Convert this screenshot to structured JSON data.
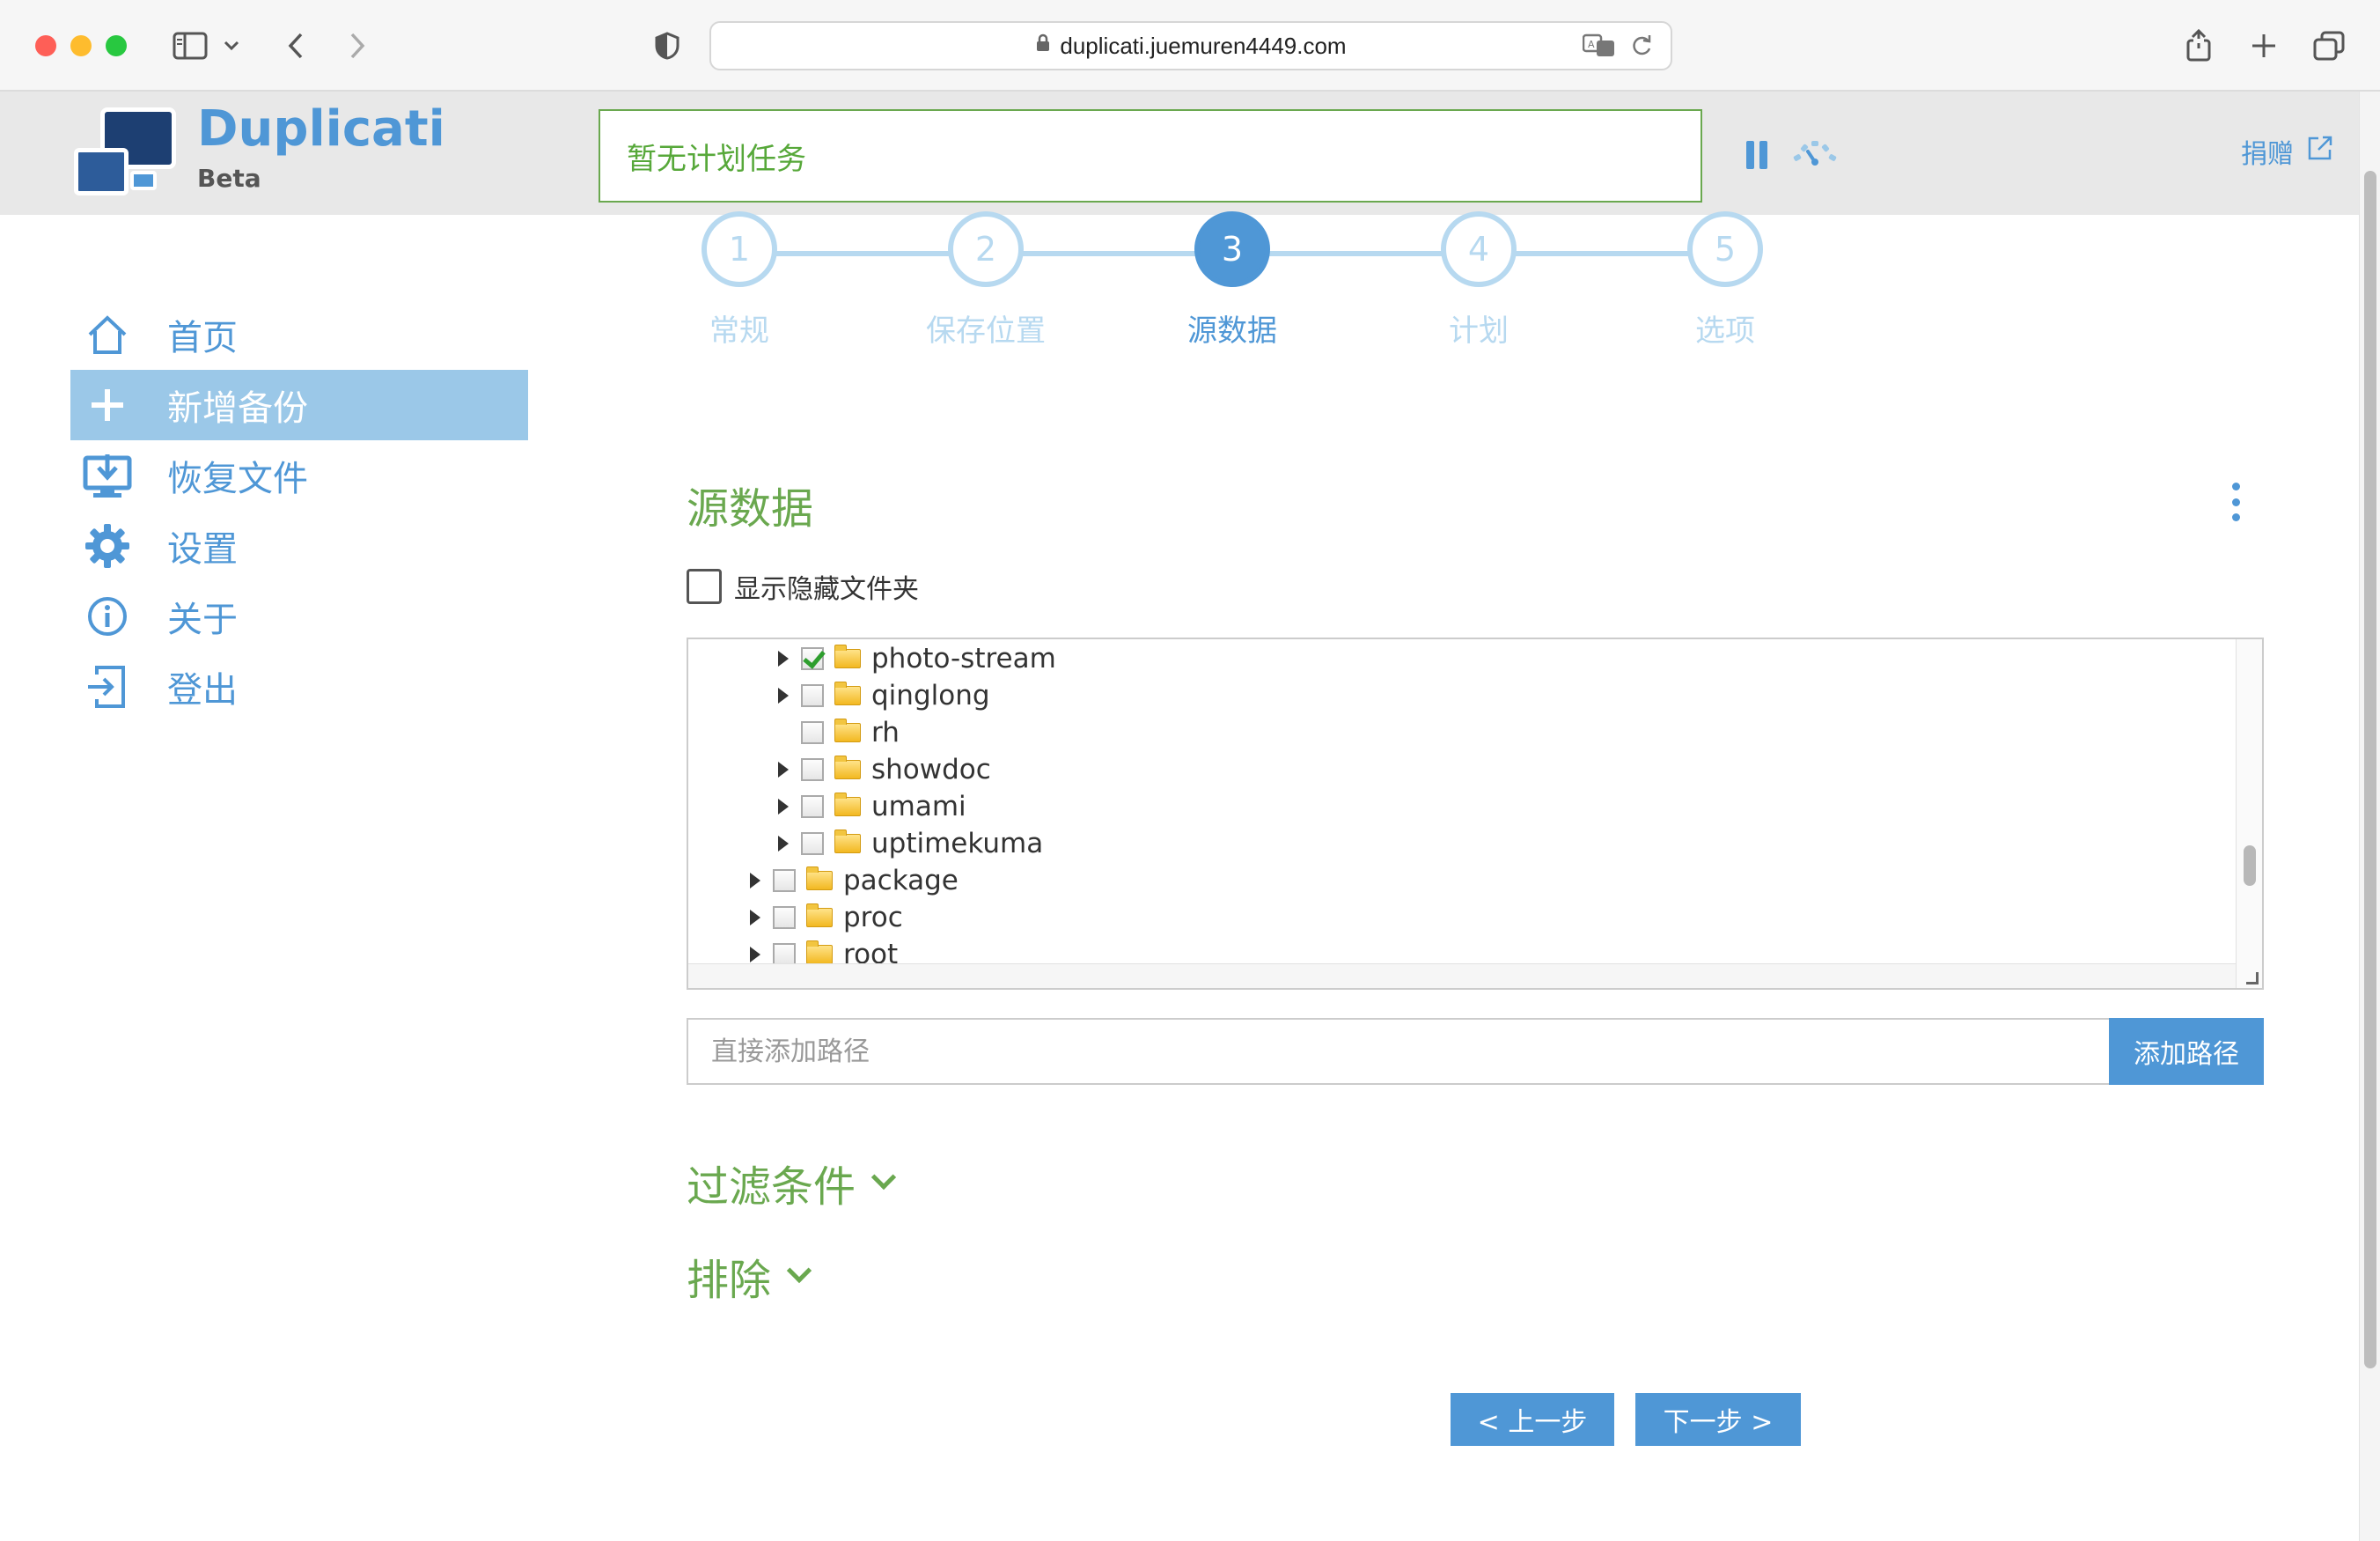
{
  "browser": {
    "url": "duplicati.juemuren4449.com"
  },
  "app": {
    "brand_name": "Duplicati",
    "brand_sub": "Beta",
    "status": "暂无计划任务",
    "donate_label": "捐赠",
    "accent_color": "#4f97d6",
    "green_color": "#6aa84f"
  },
  "sidebar": {
    "items": [
      {
        "label": "首页",
        "icon": "home-icon"
      },
      {
        "label": "新增备份",
        "icon": "plus-icon",
        "active": true
      },
      {
        "label": "恢复文件",
        "icon": "restore-icon"
      },
      {
        "label": "设置",
        "icon": "gear-icon"
      },
      {
        "label": "关于",
        "icon": "info-icon"
      },
      {
        "label": "登出",
        "icon": "logout-icon"
      }
    ]
  },
  "stepper": {
    "steps": [
      {
        "number": "1",
        "label": "常规"
      },
      {
        "number": "2",
        "label": "保存位置"
      },
      {
        "number": "3",
        "label": "源数据",
        "active": true
      },
      {
        "number": "4",
        "label": "计划"
      },
      {
        "number": "5",
        "label": "选项"
      }
    ]
  },
  "source": {
    "title": "源数据",
    "show_hidden_label": "显示隐藏文件夹",
    "tree": [
      {
        "label": "photo-stream",
        "expandable": true,
        "checked": true,
        "level": 2
      },
      {
        "label": "qinglong",
        "expandable": true,
        "checked": false,
        "level": 2
      },
      {
        "label": "rh",
        "expandable": false,
        "checked": false,
        "level": 2
      },
      {
        "label": "showdoc",
        "expandable": true,
        "checked": false,
        "level": 2
      },
      {
        "label": "umami",
        "expandable": true,
        "checked": false,
        "level": 2
      },
      {
        "label": "uptimekuma",
        "expandable": true,
        "checked": false,
        "level": 2
      },
      {
        "label": "package",
        "expandable": true,
        "checked": false,
        "level": 1
      },
      {
        "label": "proc",
        "expandable": true,
        "checked": false,
        "level": 1
      },
      {
        "label": "root",
        "expandable": true,
        "checked": false,
        "level": 1
      }
    ],
    "path_placeholder": "直接添加路径",
    "add_path_label": "添加路径"
  },
  "filters": {
    "title": "过滤条件"
  },
  "excludes": {
    "title": "排除"
  },
  "footer": {
    "prev_label": "< 上一步",
    "next_label": "下一步 >"
  }
}
